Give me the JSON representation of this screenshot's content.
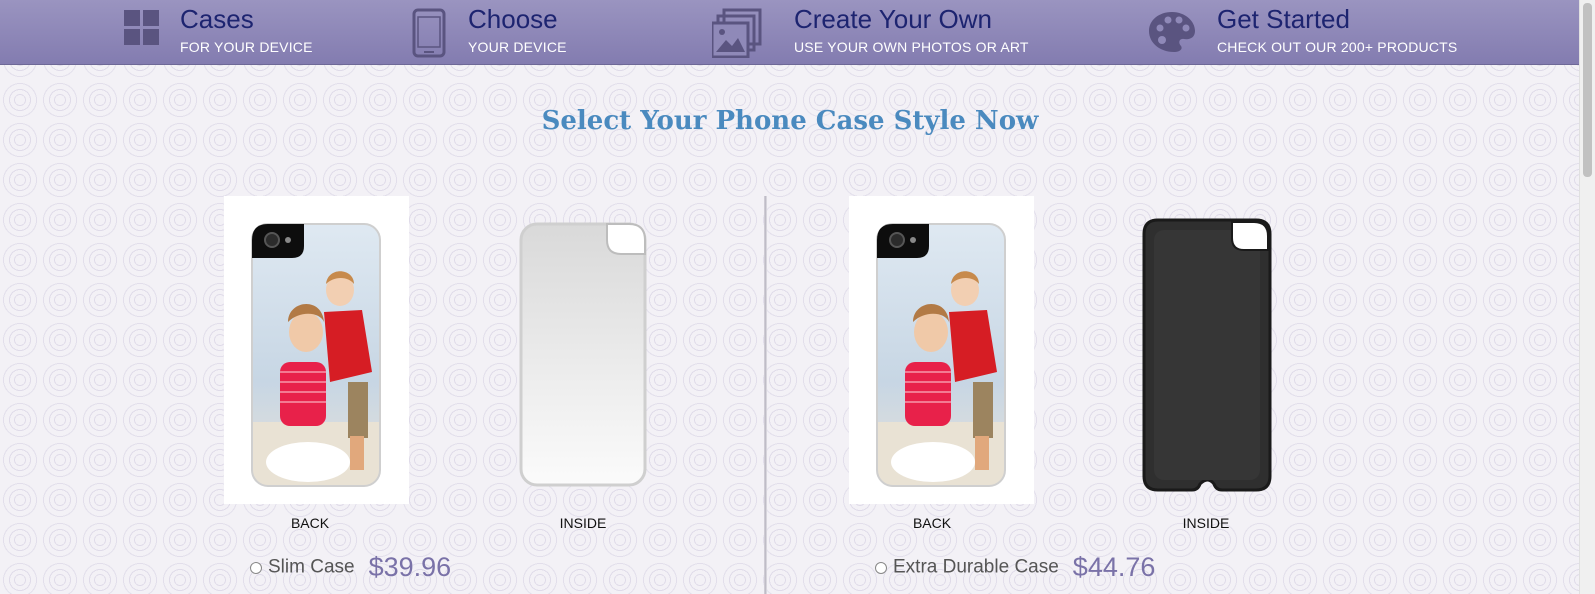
{
  "nav": {
    "items": [
      {
        "title": "Cases",
        "subtitle": "FOR YOUR DEVICE",
        "icon": "grid-icon"
      },
      {
        "title": "Choose",
        "subtitle": "YOUR DEVICE",
        "icon": "phone-icon"
      },
      {
        "title": "Create Your Own",
        "subtitle": "USE YOUR OWN PHOTOS OR ART",
        "icon": "photo-icon"
      },
      {
        "title": "Get Started",
        "subtitle": "CHECK OUT OUR 200+ PRODUCTS",
        "icon": "palette-icon"
      }
    ]
  },
  "page": {
    "title": "Select Your Phone Case Style Now"
  },
  "products": [
    {
      "back_label": "BACK",
      "inside_label": "INSIDE",
      "name": "Slim Case",
      "price": "$39.96"
    },
    {
      "back_label": "BACK",
      "inside_label": "INSIDE",
      "name": "Extra Durable Case",
      "price": "$44.76"
    }
  ],
  "colors": {
    "nav_bg": "#8f89b8",
    "nav_title": "#1d2470",
    "page_title": "#4a8abf",
    "price": "#7a72a8"
  }
}
